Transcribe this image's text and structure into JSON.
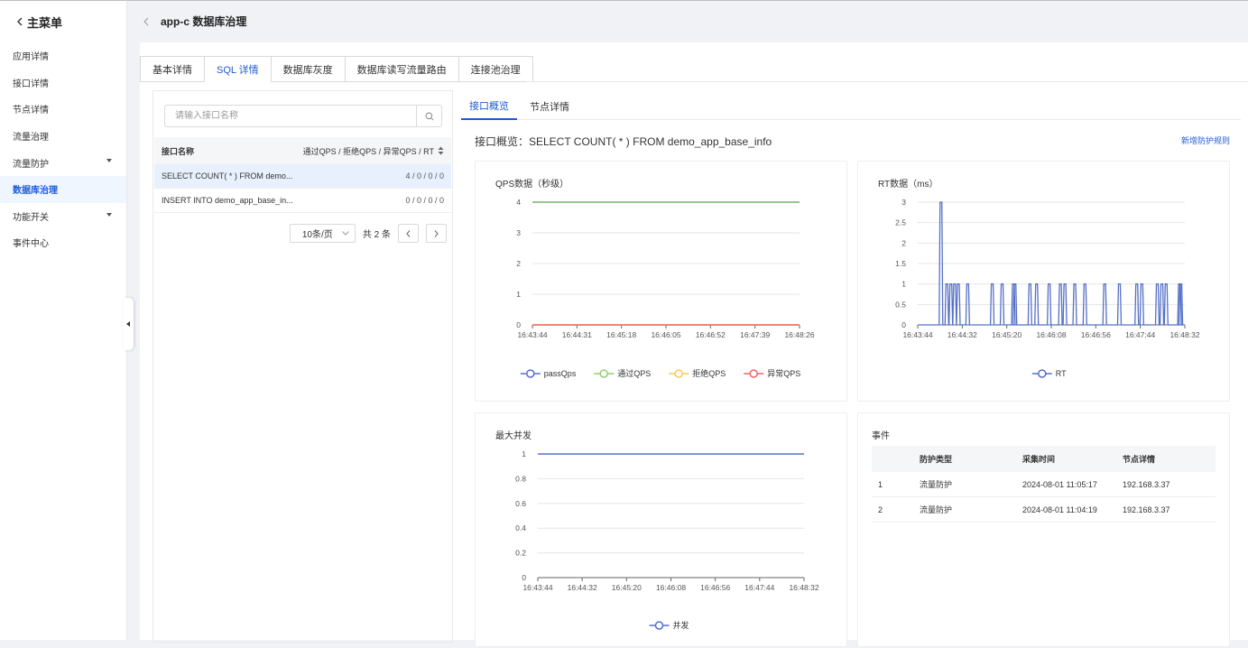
{
  "sidebar": {
    "back_label": "主菜单",
    "items": [
      {
        "label": "应用详情",
        "active": false,
        "caret": false
      },
      {
        "label": "接口详情",
        "active": false,
        "caret": false
      },
      {
        "label": "节点详情",
        "active": false,
        "caret": false
      },
      {
        "label": "流量治理",
        "active": false,
        "caret": false
      },
      {
        "label": "流量防护",
        "active": false,
        "caret": true
      },
      {
        "label": "数据库治理",
        "active": true,
        "caret": false
      },
      {
        "label": "功能开关",
        "active": false,
        "caret": true
      },
      {
        "label": "事件中心",
        "active": false,
        "caret": false
      }
    ]
  },
  "header": {
    "title": "app-c 数据库治理"
  },
  "tabs": [
    {
      "label": "基本详情",
      "active": false
    },
    {
      "label": "SQL 详情",
      "active": true
    },
    {
      "label": "数据库灰度",
      "active": false
    },
    {
      "label": "数据库读写流量路由",
      "active": false
    },
    {
      "label": "连接池治理",
      "active": false
    }
  ],
  "left": {
    "search_placeholder": "请输入接口名称",
    "col_name": "接口名称",
    "col_metrics": "通过QPS / 拒绝QPS / 异常QPS / RT",
    "rows": [
      {
        "name": "SELECT COUNT( * ) FROM demo...",
        "value": "4 / 0 / 0 / 0",
        "selected": true
      },
      {
        "name": "INSERT INTO demo_app_base_in...",
        "value": "0 / 0 / 0 / 0",
        "selected": false
      }
    ],
    "page_size": "10条/页",
    "total": "共 2 条"
  },
  "subtabs": [
    {
      "label": "接口概览",
      "active": true
    },
    {
      "label": "节点详情",
      "active": false
    }
  ],
  "overview": {
    "title": "接口概览：SELECT COUNT( * ) FROM demo_app_base_info",
    "add_rule_link": "新增防护规则"
  },
  "colors": {
    "primary": "#1f5bd6",
    "pass": "#5470c6",
    "pass_cn": "#91cc75",
    "block": "#fac858",
    "error": "#ee6666"
  },
  "chart_data": [
    {
      "type": "line",
      "title": "QPS数据（秒级）",
      "x": [
        "16:43:44",
        "16:44:31",
        "16:45:18",
        "16:46:05",
        "16:46:52",
        "16:47:39",
        "16:48:26"
      ],
      "ylim": [
        0,
        4
      ],
      "yticks": [
        0,
        1,
        2,
        3,
        4
      ],
      "series": [
        {
          "name": "passQps",
          "values": [
            4,
            4,
            4,
            4,
            4,
            4,
            4
          ],
          "color": "#5470c6"
        },
        {
          "name": "通过QPS",
          "values": [
            4,
            4,
            4,
            4,
            4,
            4,
            4
          ],
          "color": "#91cc75"
        },
        {
          "name": "拒绝QPS",
          "values": [
            0,
            0,
            0,
            0,
            0,
            0,
            0
          ],
          "color": "#fac858"
        },
        {
          "name": "异常QPS",
          "values": [
            0,
            0,
            0,
            0,
            0,
            0,
            0
          ],
          "color": "#ee6666"
        }
      ],
      "legend": "bottom"
    },
    {
      "type": "line",
      "title": "RT数据（ms）",
      "x": [
        "16:43:44",
        "16:44:32",
        "16:45:20",
        "16:46:08",
        "16:46:56",
        "16:47:44",
        "16:48:32"
      ],
      "ylim": [
        0,
        3
      ],
      "yticks": [
        0,
        0.5,
        1,
        1.5,
        2,
        2.5,
        3
      ],
      "series": [
        {
          "name": "RT",
          "color": "#5470c6",
          "spikes_at": [
            0.087,
            0.109,
            0.124,
            0.138,
            0.152,
            0.187,
            0.279,
            0.316,
            0.358,
            0.364,
            0.42,
            0.445,
            0.492,
            0.534,
            0.551,
            0.588,
            0.626,
            0.7,
            0.755,
            0.82,
            0.839,
            0.897,
            0.914,
            0.93,
            0.98,
            0.985
          ],
          "spike_values": [
            3,
            1,
            1,
            1,
            1,
            1,
            1,
            1,
            1,
            1,
            1,
            1,
            1,
            1,
            1,
            1,
            1,
            1,
            1,
            1,
            1,
            1,
            1,
            1,
            1,
            1
          ],
          "baseline": 0
        }
      ],
      "legend": "bottom"
    },
    {
      "type": "line",
      "title": "最大并发",
      "x": [
        "16:43:44",
        "16:44:32",
        "16:45:20",
        "16:46:08",
        "16:46:56",
        "16:47:44",
        "16:48:32"
      ],
      "ylim": [
        0,
        1
      ],
      "yticks": [
        0,
        0.2,
        0.4,
        0.6,
        0.8,
        1
      ],
      "series": [
        {
          "name": "并发",
          "values": [
            1,
            1,
            1,
            1,
            1,
            1,
            1
          ],
          "color": "#5470c6"
        }
      ],
      "legend": "bottom"
    }
  ],
  "events": {
    "title": "事件",
    "headers": [
      "",
      "防护类型",
      "采集时间",
      "节点详情"
    ],
    "rows": [
      [
        "1",
        "流量防护",
        "2024-08-01 11:05:17",
        "192.168.3.37"
      ],
      [
        "2",
        "流量防护",
        "2024-08-01 11:04:19",
        "192.168.3.37"
      ]
    ]
  }
}
